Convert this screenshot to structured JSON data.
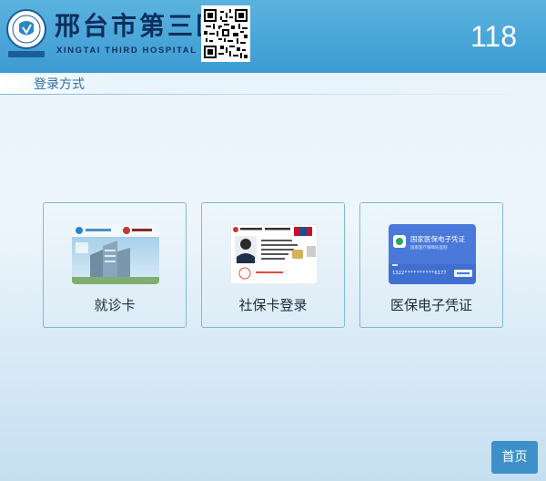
{
  "header": {
    "hospital_name_cn": "邢台市第三医院",
    "hospital_name_en": "XINGTAI THIRD HOSPITAL",
    "counter": "118"
  },
  "section": {
    "title": "登录方式"
  },
  "options": [
    {
      "label": "就诊卡",
      "icon": "hospital-card-icon"
    },
    {
      "label": "社保卡登录",
      "icon": "social-security-card-icon"
    },
    {
      "label": "医保电子凭证",
      "icon": "medical-insurance-ecert-icon"
    }
  ],
  "ecert_card": {
    "title": "国家医保电子凭证",
    "subtitle": "国家医疗保障局监制",
    "number": "1322**********6177"
  },
  "footer": {
    "home_label": "首页"
  },
  "colors": {
    "header": "#4aa6d9",
    "brand_text": "#0d2f5c",
    "accent_button": "#3e91c8",
    "section_text": "#2a6fa8"
  }
}
